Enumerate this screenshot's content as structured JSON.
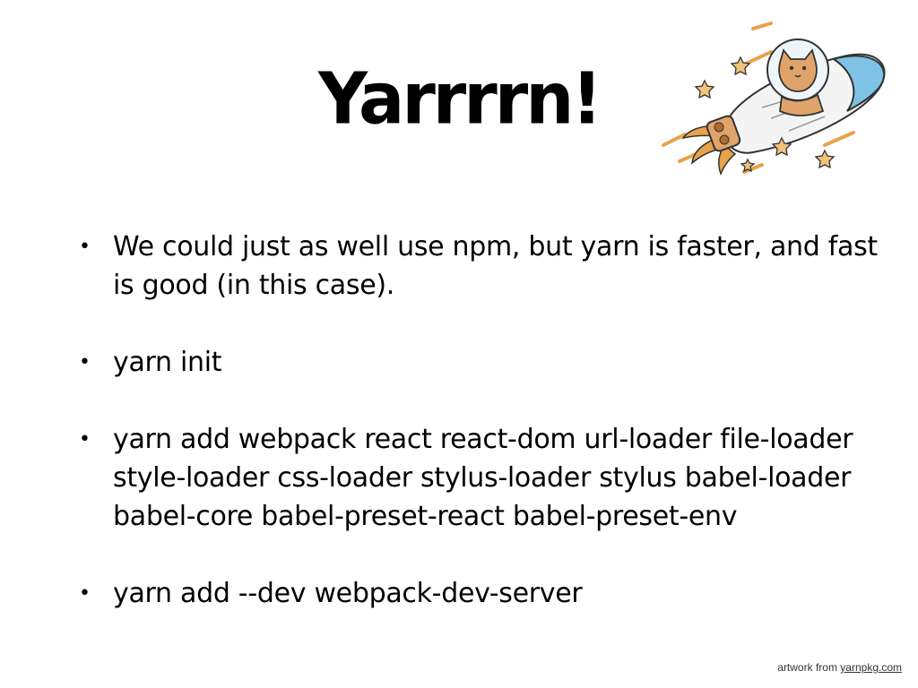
{
  "slide": {
    "title": "Yarrrrn!",
    "bullets": [
      {
        "text": "We could just as well use npm, but yarn is faster, and fast is good (in this case)."
      },
      {
        "text": "yarn init"
      },
      {
        "text": "yarn add webpack react react-dom url-loader file-loader style-loader css-loader stylus-loader stylus babel-loader babel-core babel-preset-react babel-preset-env"
      },
      {
        "text": "yarn add --dev webpack-dev-server"
      }
    ],
    "credit_prefix": "artwork from",
    "credit_link": "yarnpkg.com",
    "illustration": "cat-astronaut-rocket-icon",
    "colors": {
      "rocket_blue": "#7ec3e6",
      "cat_orange": "#e0a46a",
      "star_orange": "#e8a24a"
    }
  }
}
